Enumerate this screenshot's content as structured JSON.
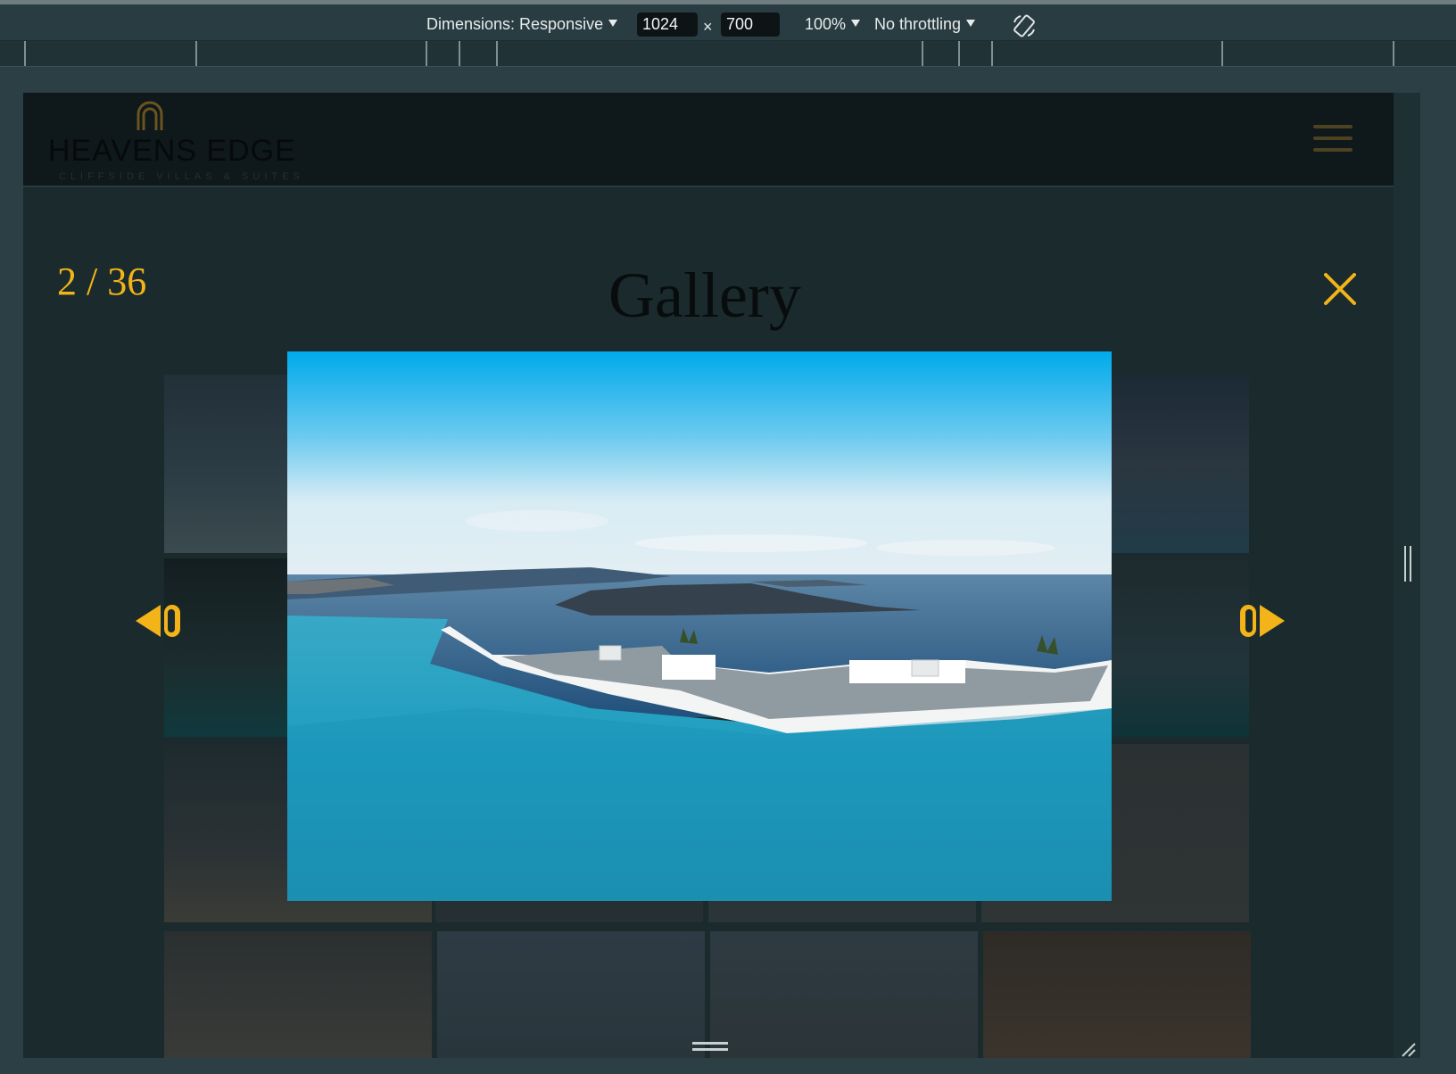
{
  "devtools": {
    "dimensions_label": "Dimensions: Responsive",
    "width_value": "1024",
    "times": "×",
    "height_value": "700",
    "zoom": "100%",
    "throttling": "No throttling"
  },
  "site": {
    "logo_text": "HEAVENS EDGE",
    "logo_tagline": "CLIFFSIDE VILLAS & SUITES",
    "page_title": "Gallery"
  },
  "lightbox": {
    "counter": "2 / 36",
    "image_subject": "infinity pool overlooking Santorini caldera"
  },
  "colors": {
    "accent": "#f2b418",
    "overlay": "#1b2a2d",
    "toolbar": "#293c41"
  },
  "icons": {
    "rotate": "rotate-icon",
    "close": "close-icon",
    "prev": "prev-arrow-icon",
    "next": "next-arrow-icon",
    "menu": "hamburger-icon"
  }
}
